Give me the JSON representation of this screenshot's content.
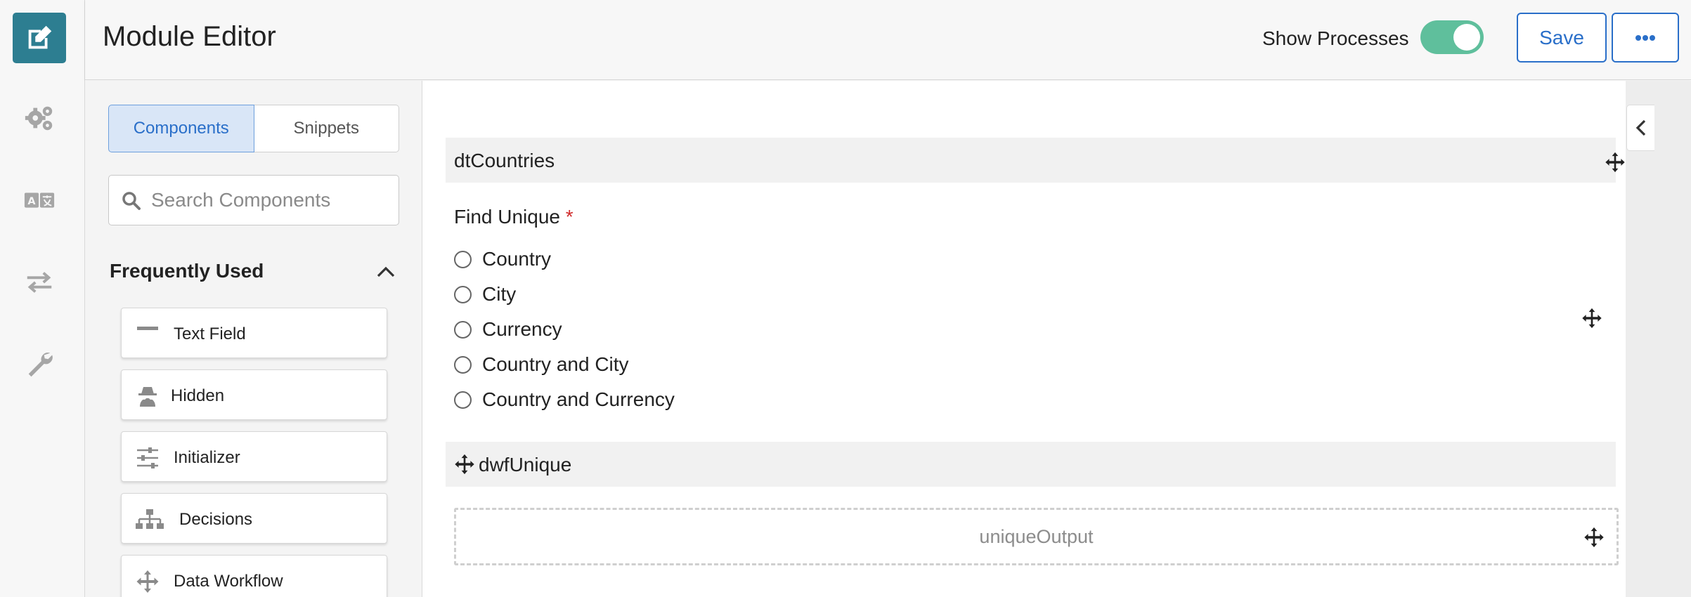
{
  "header": {
    "title": "Module Editor",
    "toggle_label": "Show Processes",
    "toggle_on": true,
    "save_label": "Save"
  },
  "rail": {
    "items": [
      {
        "icon": "edit-icon",
        "active": true
      },
      {
        "icon": "gears-icon",
        "active": false
      },
      {
        "icon": "translate-icon",
        "active": false
      },
      {
        "icon": "transfer-arrows-icon",
        "active": false
      },
      {
        "icon": "wrench-icon",
        "active": false
      }
    ]
  },
  "panel": {
    "tabs": [
      {
        "label": "Components",
        "active": true
      },
      {
        "label": "Snippets",
        "active": false
      }
    ],
    "search_placeholder": "Search Components",
    "section_title": "Frequently Used",
    "components": [
      {
        "label": "Text Field",
        "icon": "text-field-icon"
      },
      {
        "label": "Hidden",
        "icon": "spy-icon"
      },
      {
        "label": "Initializer",
        "icon": "sliders-icon"
      },
      {
        "label": "Decisions",
        "icon": "sitemap-icon"
      },
      {
        "label": "Data Workflow",
        "icon": "move-icon"
      }
    ]
  },
  "canvas": {
    "table_block": "dtCountries",
    "radio_label": "Find Unique",
    "required_mark": "*",
    "radio_options": [
      "Country",
      "City",
      "Currency",
      "Country and City",
      "Country and Currency"
    ],
    "workflow_block": "dwfUnique",
    "output_placeholder": "uniqueOutput"
  },
  "colors": {
    "accent": "#2a6fc9",
    "rail_active": "#2d7e91",
    "toggle": "#5fbf9c",
    "required": "#d02b2b"
  }
}
